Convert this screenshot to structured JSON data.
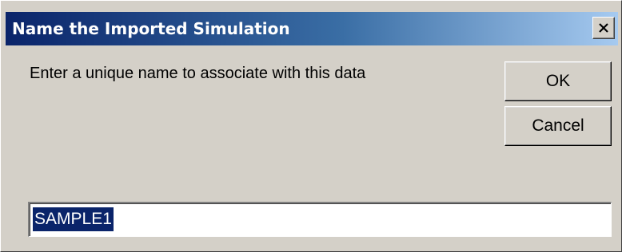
{
  "dialog": {
    "title": "Name the Imported Simulation",
    "prompt": "Enter a unique name to associate with this data",
    "ok_label": "OK",
    "cancel_label": "Cancel",
    "name_value": "SAMPLE1",
    "close_icon": "close-icon"
  }
}
